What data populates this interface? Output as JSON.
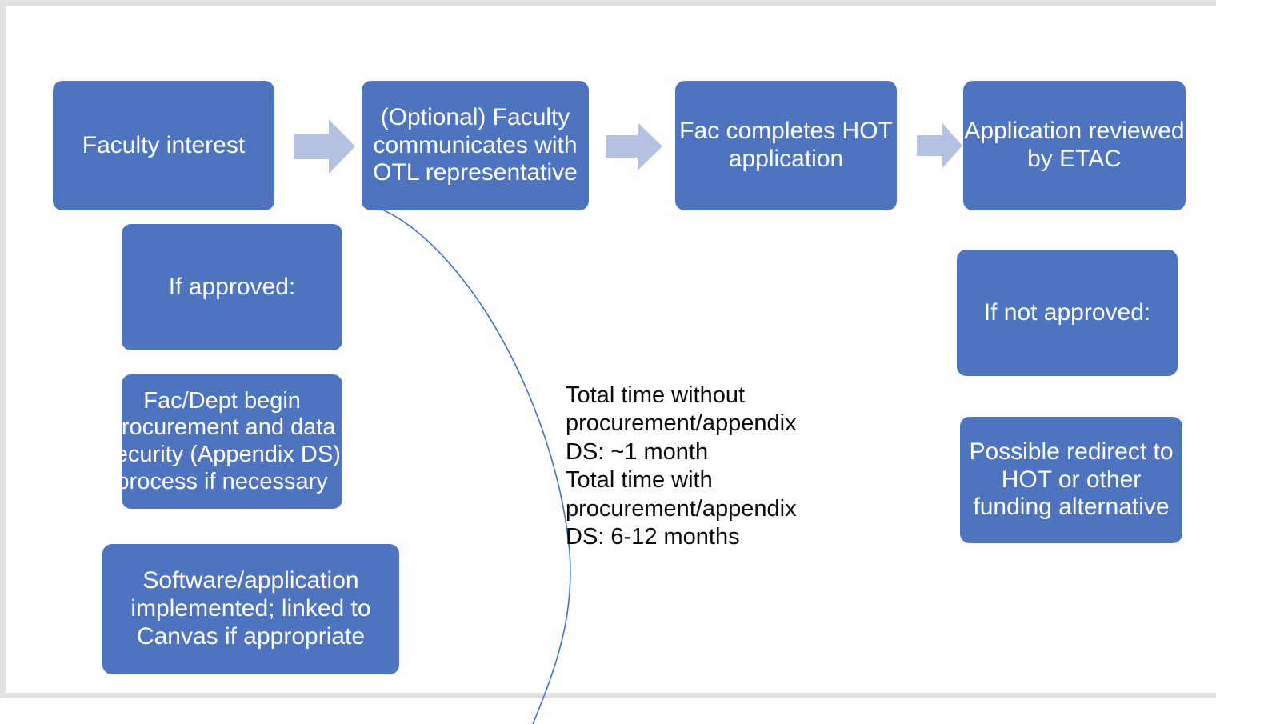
{
  "slide": {
    "background_color": "#ffffff",
    "frame_color": "#e2e2e2",
    "box_color": "#4f74bf",
    "arrow_color": "#b4c2e2",
    "connector_color": "#4472c4",
    "box_text_color": "#ffffff",
    "note_text_color": "#0a0a0a"
  },
  "flow": {
    "top_row": [
      {
        "id": "faculty-interest",
        "label": "Faculty interest"
      },
      {
        "id": "otl-communication",
        "label": "(Optional) Faculty communicates with OTL representative"
      },
      {
        "id": "hot-application",
        "label": "Fac completes HOT application"
      },
      {
        "id": "etac-review",
        "label": "Application reviewed by ETAC"
      }
    ],
    "approved_branch": [
      {
        "id": "if-approved",
        "label": "If approved:"
      },
      {
        "id": "procurement",
        "label": "Fac/Dept begin procurement and data security (Appendix DS) process if necessary"
      },
      {
        "id": "implemented",
        "label": "Software/application implemented; linked to Canvas if appropriate"
      }
    ],
    "not_approved_branch": [
      {
        "id": "if-not-approved",
        "label": "If not approved:"
      },
      {
        "id": "redirect",
        "label": "Possible redirect to HOT or other funding alternative"
      }
    ],
    "arrows": [
      {
        "id": "arrow-1",
        "name": "arrow-right-icon"
      },
      {
        "id": "arrow-2",
        "name": "arrow-right-icon"
      },
      {
        "id": "arrow-3",
        "name": "arrow-right-icon"
      }
    ],
    "timing_note": "Total time without procurement/appendix DS: ~1 month\nTotal time with procurement/appendix DS: 6-12 months"
  }
}
